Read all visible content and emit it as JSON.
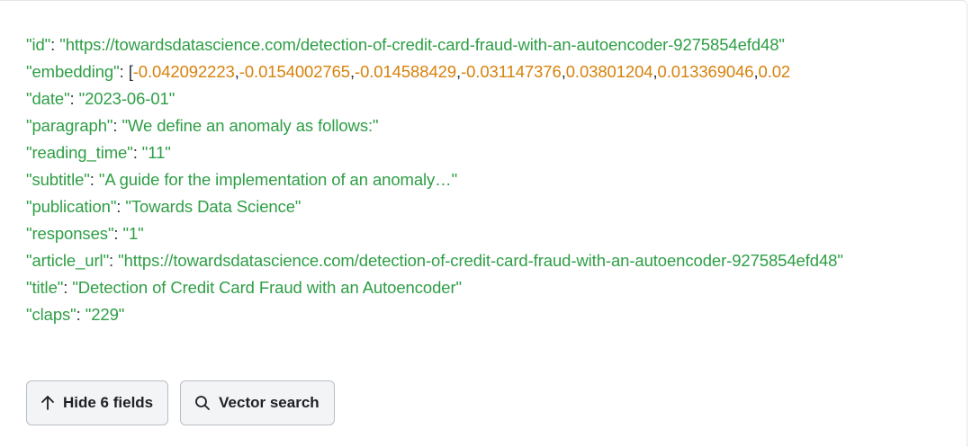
{
  "fields": [
    {
      "key": "id",
      "value": "https://towardsdatascience.com/detection-of-credit-card-fraud-with-an-autoencoder-9275854efd48"
    },
    {
      "key": "embedding",
      "numbers": [
        "-0.042092223",
        "-0.0154002765",
        "-0.014588429",
        "-0.031147376",
        "0.03801204",
        "0.013369046",
        "0.02"
      ]
    },
    {
      "key": "date",
      "value": "2023-06-01"
    },
    {
      "key": "paragraph",
      "value": "We define an anomaly as follows:"
    },
    {
      "key": "reading_time",
      "value": "11"
    },
    {
      "key": "subtitle",
      "value": "A guide for the implementation of an anomaly…"
    },
    {
      "key": "publication",
      "value": "Towards Data Science"
    },
    {
      "key": "responses",
      "value": "1"
    },
    {
      "key": "article_url",
      "value": "https://towardsdatascience.com/detection-of-credit-card-fraud-with-an-autoencoder-9275854efd48"
    },
    {
      "key": "title",
      "value": "Detection of Credit Card Fraud with an Autoencoder"
    },
    {
      "key": "claps",
      "value": "229"
    }
  ],
  "buttons": {
    "hide_fields": {
      "label": "Hide 6 fields",
      "icon": "arrow-up-icon"
    },
    "vector_search": {
      "label": "Vector search",
      "icon": "search-icon"
    }
  },
  "colors": {
    "string": "#2e9e45",
    "number": "#d6820d",
    "punctuation": "#2a2f36"
  }
}
